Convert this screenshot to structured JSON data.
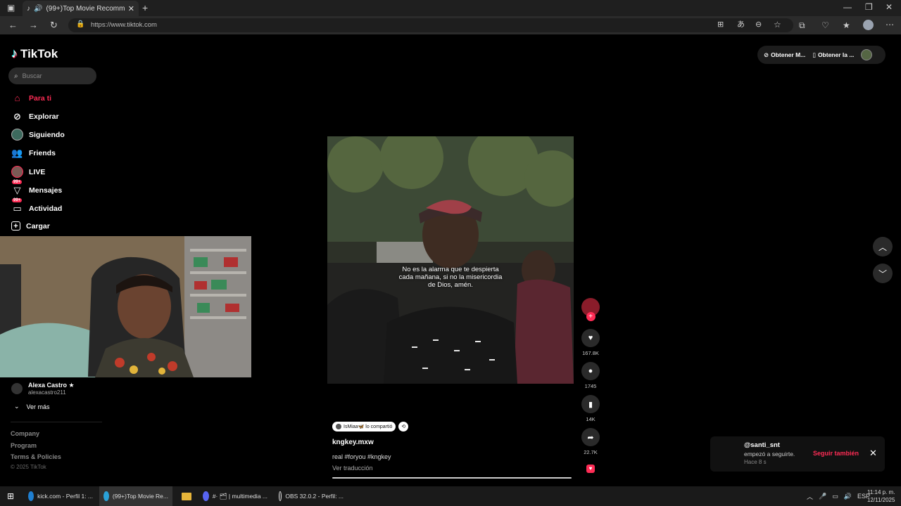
{
  "browser": {
    "tab_title": "(99+)Top Movie Recomme...",
    "url": "https://www.tiktok.com"
  },
  "app": {
    "logo": "TikTok",
    "search_placeholder": "Buscar",
    "header_links": [
      "Obtener M...",
      "Obtener la ..."
    ]
  },
  "sidebar": {
    "items": [
      {
        "label": "Para ti",
        "icon": "home-icon",
        "active": true
      },
      {
        "label": "Explorar",
        "icon": "compass-icon"
      },
      {
        "label": "Siguiendo",
        "icon": "following-avatar-icon"
      },
      {
        "label": "Friends",
        "icon": "friends-icon"
      },
      {
        "label": "LIVE",
        "icon": "live-avatar-icon"
      },
      {
        "label": "Mensajes",
        "icon": "messages-icon",
        "badge": "99+"
      },
      {
        "label": "Actividad",
        "icon": "activity-icon",
        "badge": "99+"
      },
      {
        "label": "Cargar",
        "icon": "upload-icon"
      }
    ],
    "following_account": {
      "name": "Alexa Castro ★",
      "handle": "alexacastro211"
    },
    "see_more": "Ver más",
    "footer": [
      "Company",
      "Program",
      "Terms & Policies"
    ],
    "copyright": "© 2025 TikTok"
  },
  "video": {
    "subtitle": "No es la alarma que te despierta cada mañana, si no la misericordia de Dios, amén.",
    "shared_by": "IsMiaa🦋 lo compartió",
    "author": "kngkey.mxw",
    "description": "real #foryou #kngkey",
    "translate": "Ver traducción",
    "likes": "167.8K",
    "comments": "1745",
    "saves": "14K",
    "shares": "22.7K"
  },
  "notification": {
    "user": "@santi_snt",
    "message": "empezó a seguirte.",
    "time": "Hace 8 s",
    "action": "Seguir también"
  },
  "taskbar": {
    "items": [
      "kick.com - Perfil 1: ...",
      "(99+)Top Movie Re...",
      "#· 🗂 | multimedia ...",
      "OBS 32.0.2 - Perfil: ..."
    ],
    "language": "ESP",
    "time": "11:14 p. m.",
    "date": "12/11/2025"
  },
  "colors": {
    "accent": "#fe2c55",
    "background": "#000000"
  }
}
